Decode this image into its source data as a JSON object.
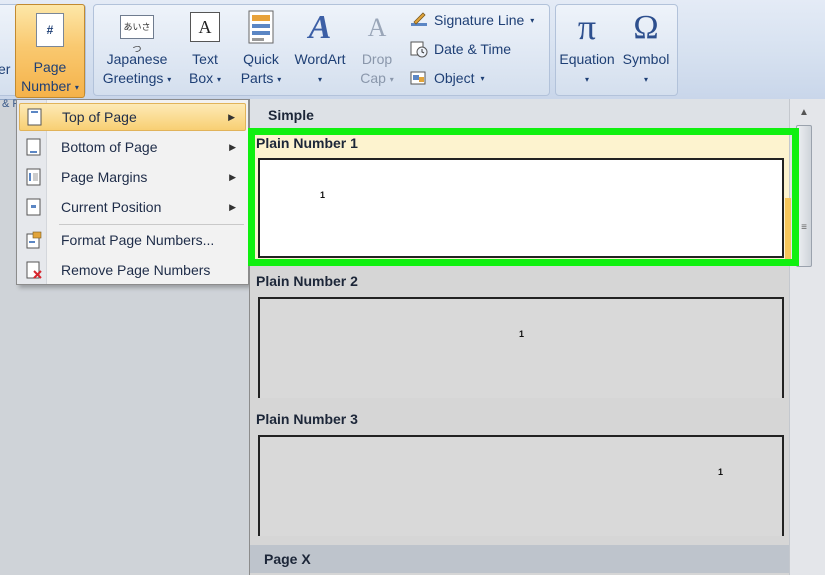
{
  "ribbon": {
    "partial_left_label": "er",
    "page_number": {
      "line1": "Page",
      "line2": "Number",
      "arrow": "▾",
      "icon_char": "#"
    },
    "japanese_greetings": {
      "line1": "Japanese",
      "line2": "Greetings",
      "arrow": "▾",
      "icon_text": "あいさつ"
    },
    "text_box": {
      "line1": "Text",
      "line2": "Box",
      "arrow": "▾",
      "icon_char": "A"
    },
    "quick_parts": {
      "line1": "Quick",
      "line2": "Parts",
      "arrow": "▾"
    },
    "wordart": {
      "line1": "WordArt",
      "arrow": "▾",
      "icon_char": "A"
    },
    "drop_cap": {
      "line1": "Drop",
      "line2": "Cap",
      "arrow": "▾",
      "icon_char": "A"
    },
    "signature_line": {
      "label": "Signature Line",
      "arrow": "▾"
    },
    "date_time": {
      "label": "Date & Time"
    },
    "object": {
      "label": "Object",
      "arrow": "▾"
    },
    "equation": {
      "label": "Equation",
      "arrow": "▾",
      "icon_char": "π"
    },
    "symbol": {
      "label": "Symbol",
      "arrow": "▾",
      "icon_char": "Ω"
    },
    "below_group_fragment": "& F"
  },
  "menu": {
    "items": [
      {
        "label": "Top of Page",
        "submenu_glyph": "▶"
      },
      {
        "label": "Bottom of Page",
        "submenu_glyph": "▶"
      },
      {
        "label": "Page Margins",
        "submenu_glyph": "▶"
      },
      {
        "label": "Current Position",
        "submenu_glyph": "▶"
      },
      {
        "label": "Format Page Numbers..."
      },
      {
        "label": "Remove Page Numbers"
      }
    ]
  },
  "gallery": {
    "header": "Simple",
    "items": [
      {
        "title": "Plain Number 1",
        "number": "1"
      },
      {
        "title": "Plain Number 2",
        "number": "1"
      },
      {
        "title": "Plain Number 3",
        "number": "1"
      }
    ],
    "next_section": "Page X",
    "scroll_up_glyph": "▲",
    "scroll_grip_glyph": "≡"
  },
  "colors": {
    "highlight": "#10f010",
    "menu_hover": "#f8cf73",
    "ribbon_text": "#1e3f75"
  }
}
